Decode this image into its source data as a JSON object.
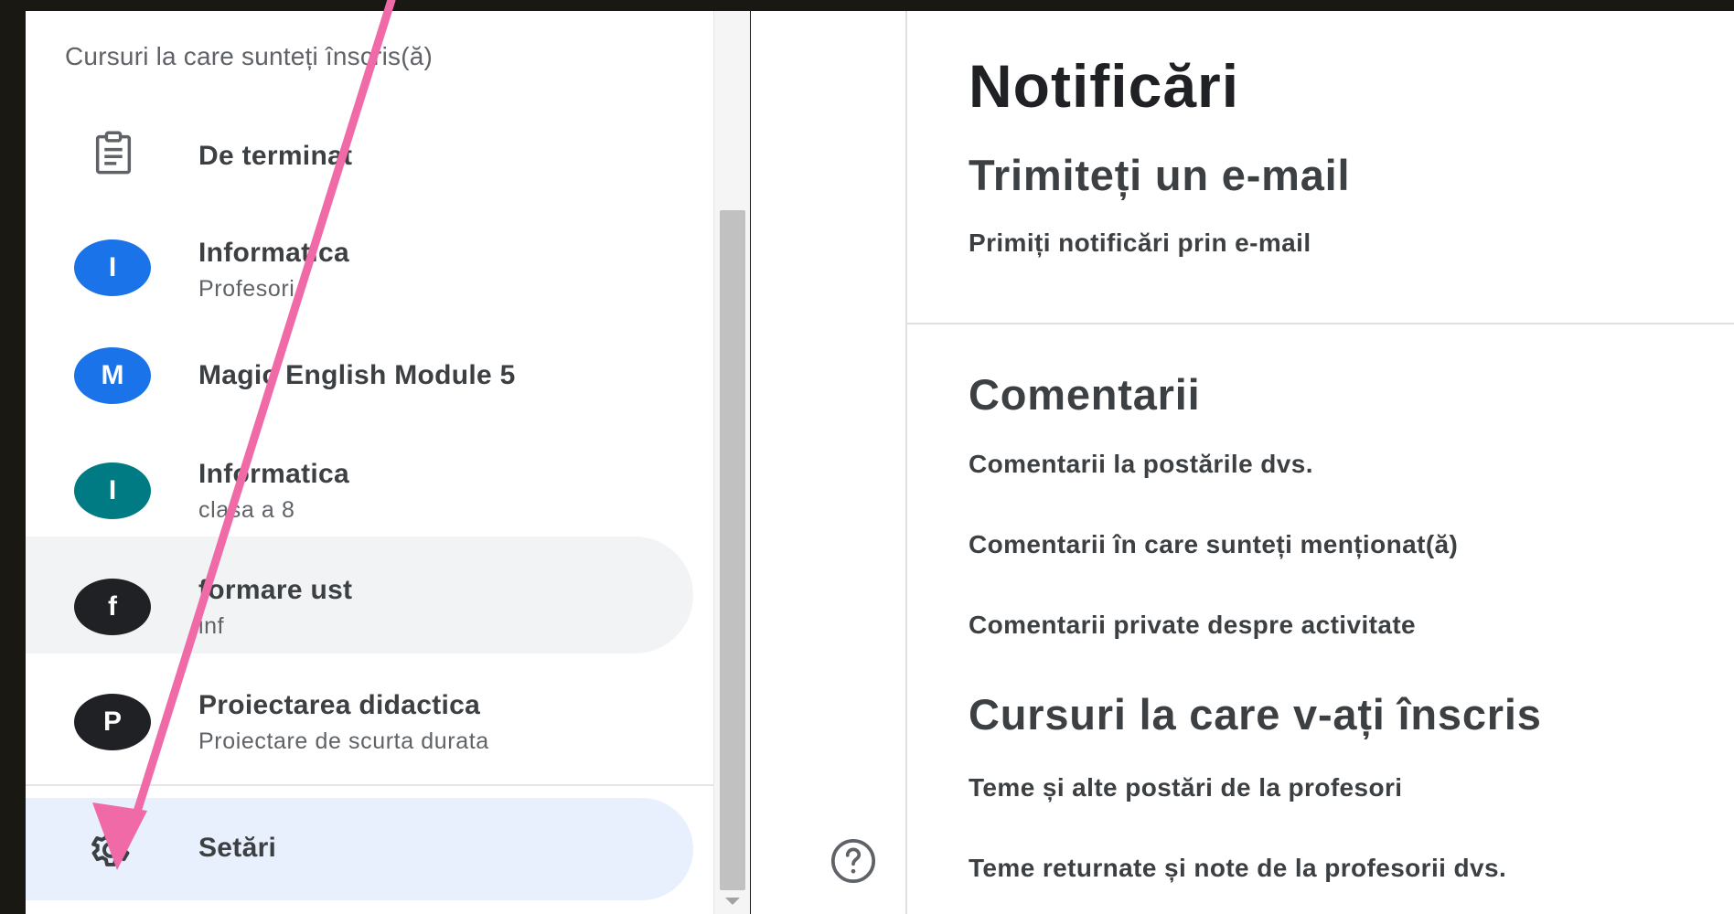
{
  "colors": {
    "background_frame": "#1a1813",
    "avatar_blue": "#1a73e8",
    "avatar_teal": "#007b83",
    "avatar_dark": "#202124",
    "settings_highlight": "#e8f0fe",
    "annotation_arrow": "#f06aa8"
  },
  "sidebar": {
    "heading": "Cursuri la care sunteți înscris(ă)",
    "todo": {
      "label": "De terminat",
      "icon": "assignment-icon"
    },
    "courses": [
      {
        "initial": "I",
        "title": "Informatica",
        "subtitle": "Profesori",
        "color": "blue"
      },
      {
        "initial": "M",
        "title": "Magic English Module 5",
        "subtitle": "",
        "color": "blue"
      },
      {
        "initial": "I",
        "title": "Informatica",
        "subtitle": "clasa a 8",
        "color": "teal"
      },
      {
        "initial": "f",
        "title": "formare ust",
        "subtitle": "inf",
        "color": "dark"
      },
      {
        "initial": "P",
        "title": "Proiectarea didactica",
        "subtitle": "Proiectare de scurta durata",
        "color": "dark"
      }
    ],
    "settings": {
      "label": "Setări",
      "icon": "gear-icon"
    }
  },
  "help": {
    "icon": "help-icon"
  },
  "main": {
    "title": "Notificări",
    "email_section": {
      "heading": "Trimiteți un e-mail",
      "option": "Primiți notificări prin e-mail"
    },
    "comments_section": {
      "heading": "Comentarii",
      "options": [
        "Comentarii la postările dvs.",
        "Comentarii în care sunteți menționat(ă)",
        "Comentarii private despre activitate"
      ]
    },
    "enrolled_section": {
      "heading": "Cursuri la care v-ați înscris",
      "options": [
        "Teme și alte postări de la profesori",
        "Teme returnate și note de la profesorii dvs."
      ]
    }
  }
}
